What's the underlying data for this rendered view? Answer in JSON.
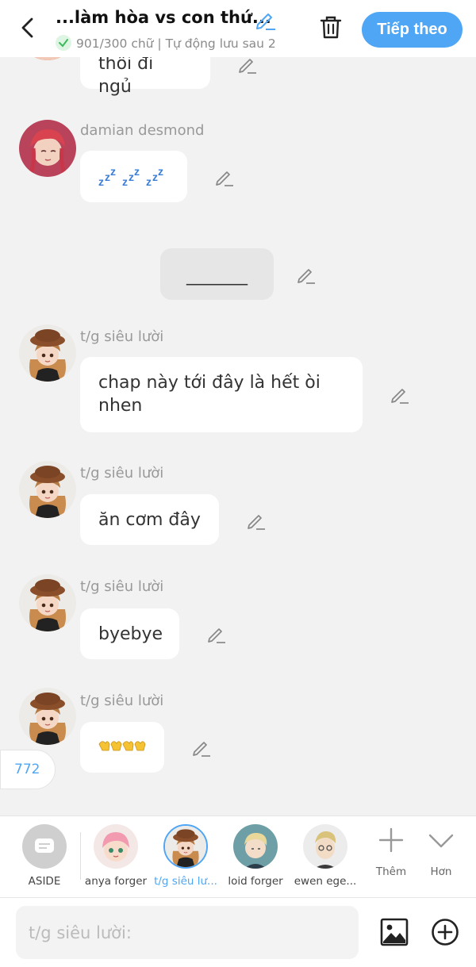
{
  "header": {
    "title": "...làm hòa vs con thứ...",
    "subtitle": "901/300 chữ | Tự động lưu sau 2",
    "next_label": "Tiếp theo"
  },
  "messages": [
    {
      "text": "thôi đi ngủ"
    },
    {
      "name": "damian desmond",
      "text": "💤💤💤"
    },
    {
      "text": "_______"
    },
    {
      "name": "t/g siêu lười",
      "text_line1": "chap này tới đây là hết òi",
      "text_line2": "nhen"
    },
    {
      "name": "t/g siêu lười",
      "text": "ăn cơm đây"
    },
    {
      "name": "t/g siêu lười",
      "text": "byebye"
    },
    {
      "name": "t/g siêu lười",
      "text": "👐👐"
    }
  ],
  "counter": "772",
  "characters": [
    {
      "name": "ASIDE"
    },
    {
      "name": "anya forger"
    },
    {
      "name": "t/g siêu lư..."
    },
    {
      "name": "loid forger"
    },
    {
      "name": "ewen ege..."
    }
  ],
  "tools": {
    "add": "Thêm",
    "more": "Hơn"
  },
  "input": {
    "placeholder": "t/g siêu lười:"
  },
  "colors": {
    "accent": "#4fa6f5",
    "background": "#f2f2f2",
    "bubble": "#ffffff",
    "center_bubble": "#e6e6e6"
  }
}
